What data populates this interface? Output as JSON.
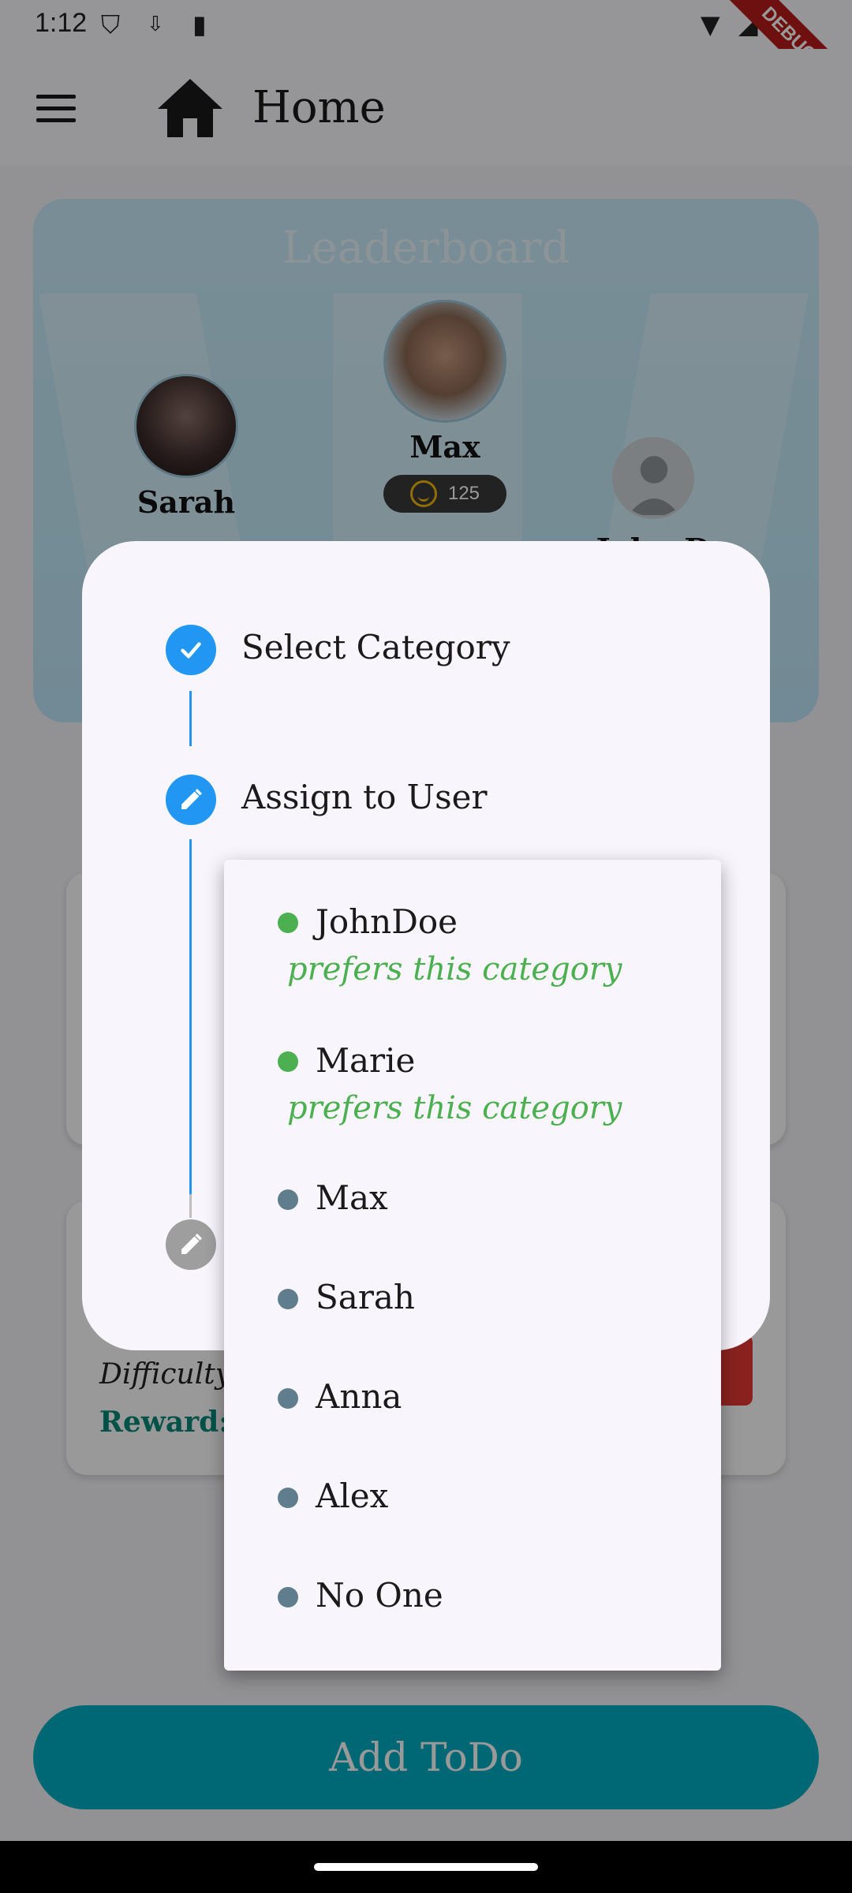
{
  "status_bar": {
    "time": "1:12",
    "debug_label": "DEBUG"
  },
  "app_bar": {
    "title": "Home"
  },
  "leaderboard": {
    "title": "Leaderboard",
    "players": [
      {
        "name": "Sarah"
      },
      {
        "name": "Max",
        "score": "125"
      },
      {
        "name": "John D"
      }
    ]
  },
  "todo_card": {
    "difficulty_label": "Difficulty",
    "reward_label": "Reward: "
  },
  "add_todo_label": "Add ToDo",
  "stepper": {
    "steps": [
      {
        "label": "Select Category",
        "state": "complete",
        "icon": "check-icon"
      },
      {
        "label": "Assign to User",
        "state": "editing",
        "icon": "edit-icon"
      },
      {
        "label": "",
        "state": "inactive",
        "icon": "edit-icon"
      }
    ]
  },
  "user_menu": {
    "preferred_color": "#4caf50",
    "default_color": "#5f7d8c",
    "items": [
      {
        "name": "JohnDoe",
        "note": "prefers this category"
      },
      {
        "name": "Marie",
        "note": "prefers this category"
      },
      {
        "name": "Max"
      },
      {
        "name": "Sarah"
      },
      {
        "name": "Anna"
      },
      {
        "name": "Alex"
      },
      {
        "name": "No One"
      }
    ]
  }
}
